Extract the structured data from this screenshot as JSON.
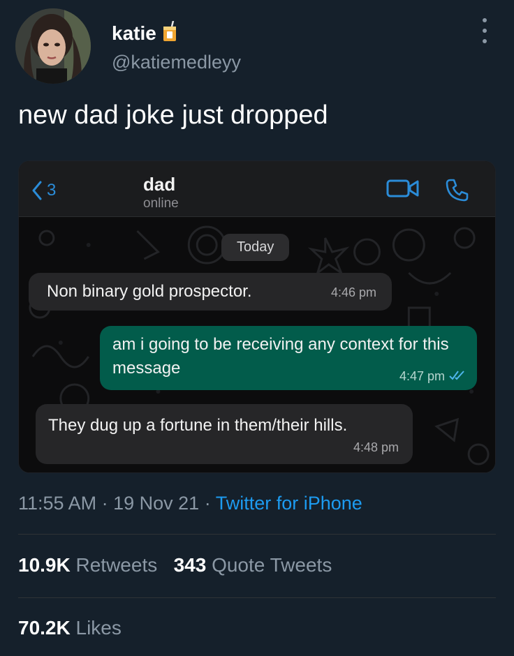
{
  "author": {
    "display_name": "katie",
    "handle": "@katiemedleyy"
  },
  "tweet": {
    "text": "new dad joke just dropped",
    "time": "11:55 AM",
    "date": "19 Nov 21",
    "source": "Twitter for iPhone",
    "separator": "·"
  },
  "embedded_chat": {
    "back_count": "3",
    "contact_name": "dad",
    "contact_status": "online",
    "date_label": "Today",
    "messages": [
      {
        "direction": "incoming",
        "text": "Non binary gold prospector.",
        "time": "4:46 pm"
      },
      {
        "direction": "outgoing",
        "text": "am i going to be receiving any context for this message",
        "time": "4:47 pm",
        "status": "read"
      },
      {
        "direction": "incoming",
        "text": "They dug up a fortune in them/their hills.",
        "time": "4:48 pm"
      }
    ],
    "icons": {
      "back": "chevron-left-icon",
      "video": "video-camera-icon",
      "call": "phone-icon",
      "read_receipt": "double-check-icon"
    },
    "colors": {
      "accent": "#2b8cd8",
      "outgoing_bubble": "#025c4b",
      "incoming_bubble": "#262628"
    }
  },
  "stats": {
    "retweets_count": "10.9K",
    "retweets_label": "Retweets",
    "quotes_count": "343",
    "quotes_label": "Quote Tweets",
    "likes_count": "70.2K",
    "likes_label": "Likes"
  },
  "colors": {
    "background": "#15202b",
    "link": "#1d9bf0",
    "muted": "#8b98a5"
  }
}
